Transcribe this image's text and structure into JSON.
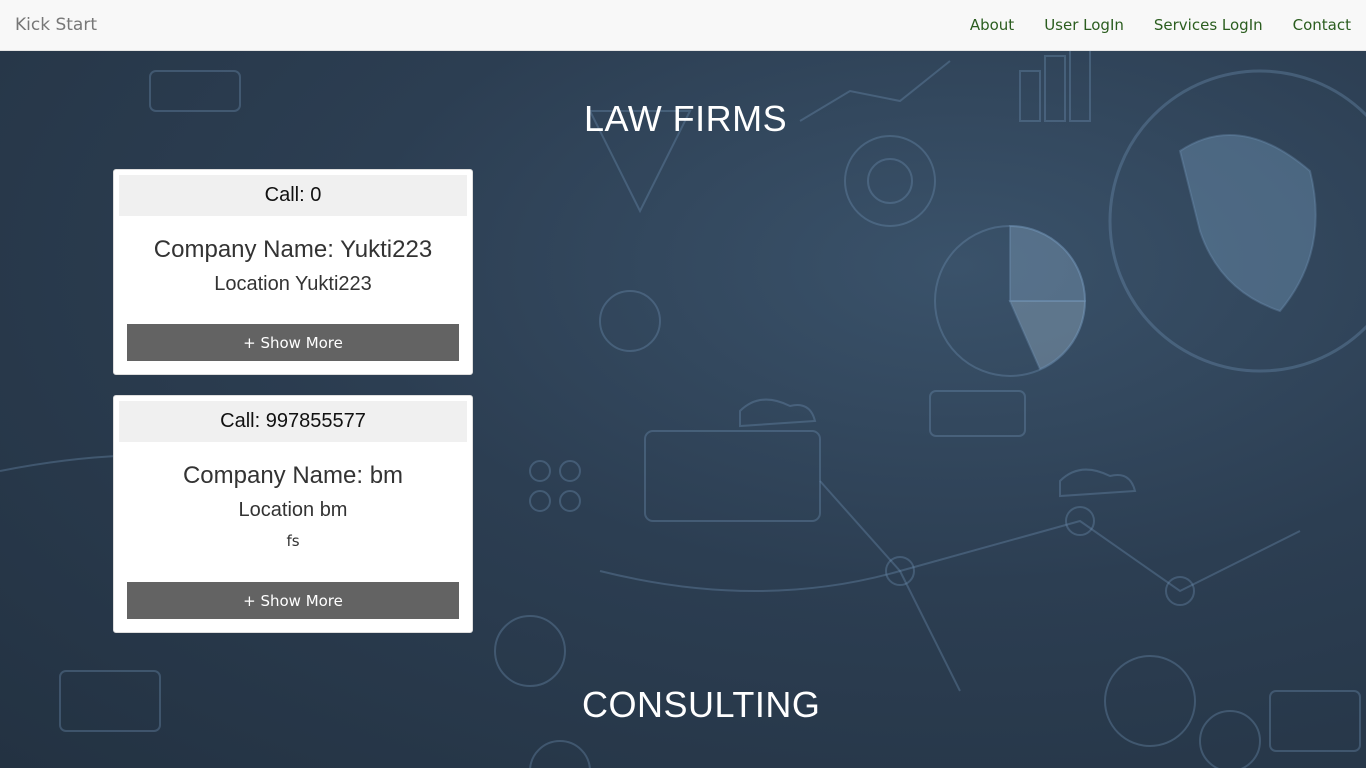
{
  "navbar": {
    "brand": "Kick Start",
    "links": [
      "About",
      "User LogIn",
      "Services LogIn",
      "Contact"
    ]
  },
  "sections": {
    "law_title": "LAW FIRMS",
    "consulting_title": "CONSULTING"
  },
  "cards": [
    {
      "call": "Call: 0",
      "company": "Company Name: Yukti223",
      "location": "Location Yukti223",
      "extra": "",
      "button": "+ Show More"
    },
    {
      "call": "Call: 997855577",
      "company": "Company Name: bm",
      "location": "Location bm",
      "extra": "fs",
      "button": "+ Show More"
    }
  ],
  "colors": {
    "nav_link": "#2b5d1f",
    "button_bg": "#636363",
    "hero_bg": "#2a3b4c"
  }
}
